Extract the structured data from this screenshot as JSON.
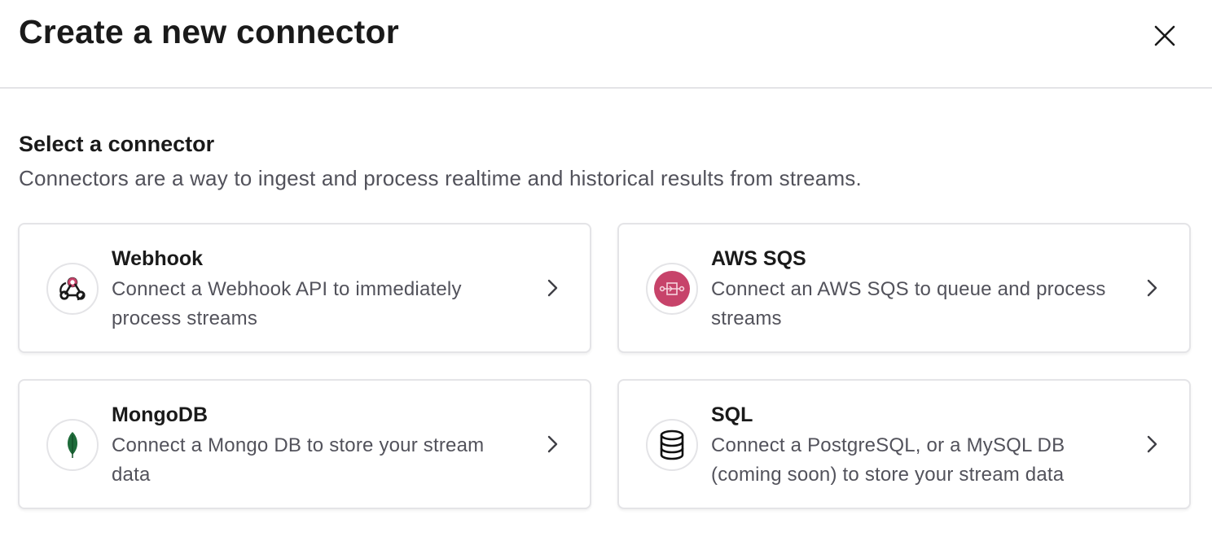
{
  "header": {
    "title": "Create a new connector"
  },
  "section": {
    "title": "Select a connector",
    "subtitle": "Connectors are a way to ingest and process realtime and historical results from streams."
  },
  "connectors": [
    {
      "name": "Webhook",
      "description": "Connect a Webhook API to immediately process streams",
      "icon": "webhook-icon"
    },
    {
      "name": "AWS SQS",
      "description": "Connect an AWS SQS to queue and process streams",
      "icon": "aws-sqs-icon",
      "icon_color": "#c7436a"
    },
    {
      "name": "MongoDB",
      "description": "Connect a Mongo DB to store your stream data",
      "icon": "mongodb-leaf-icon",
      "icon_color": "#1e6b3a"
    },
    {
      "name": "SQL",
      "description": "Connect a PostgreSQL, or a MySQL DB (coming soon) to store your stream data",
      "icon": "database-icon"
    }
  ],
  "colors": {
    "border": "#e4e4e7",
    "text_primary": "#1a1a1a",
    "text_secondary": "#52525b"
  }
}
